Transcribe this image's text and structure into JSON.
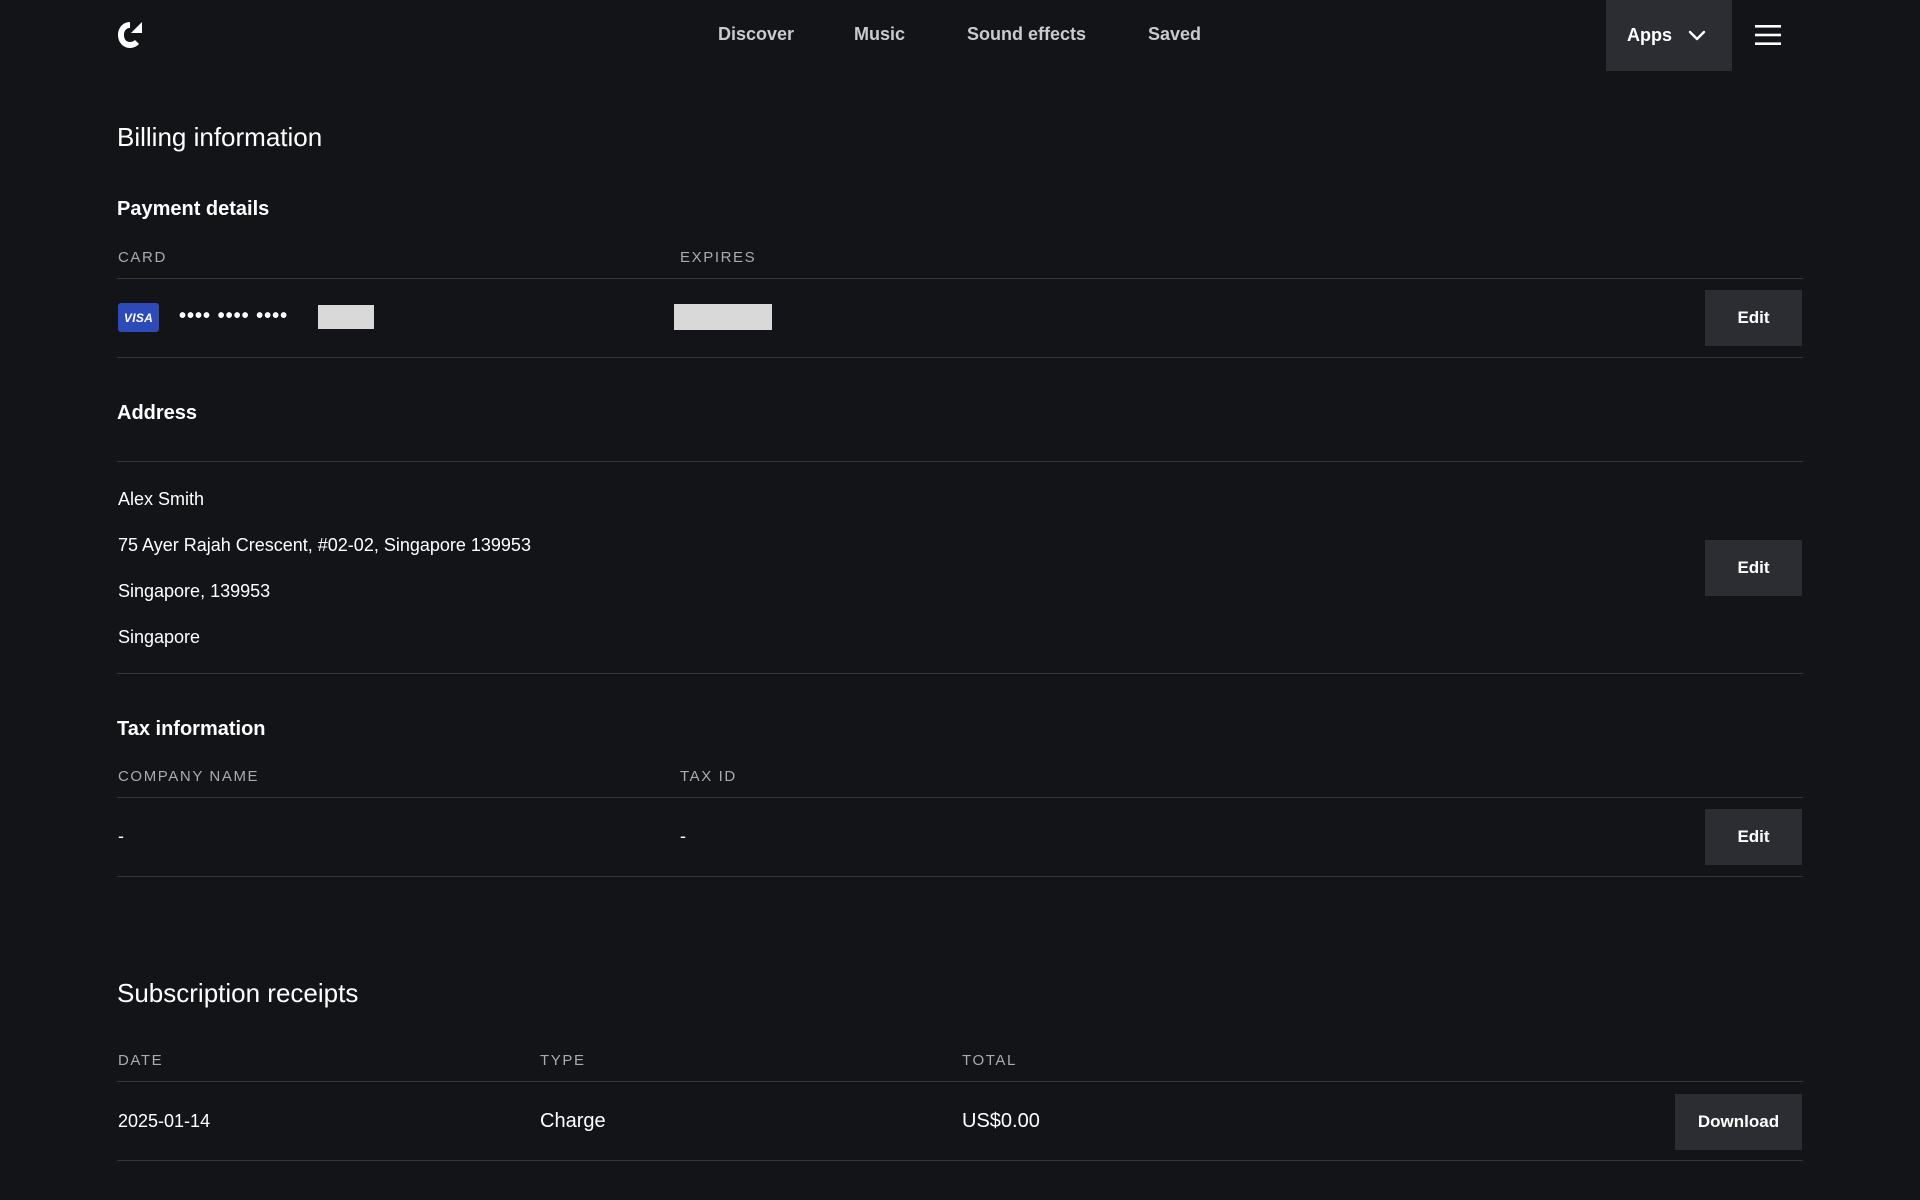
{
  "header": {
    "logo_icon": "brand-logo-icon",
    "nav": [
      {
        "label": "Discover"
      },
      {
        "label": "Music"
      },
      {
        "label": "Sound effects"
      },
      {
        "label": "Saved"
      }
    ],
    "apps_label": "Apps",
    "apps_icon": "chevron-down-icon",
    "menu_icon": "hamburger-menu-icon"
  },
  "billing": {
    "title": "Billing information",
    "payment": {
      "heading": "Payment details",
      "col_card": "CARD",
      "col_expires": "EXPIRES",
      "card_brand": "VISA",
      "card_masked": "•••• •••• ••••",
      "edit_label": "Edit"
    },
    "address": {
      "heading": "Address",
      "lines": [
        "Alex Smith",
        "75 Ayer Rajah Crescent, #02-02, Singapore 139953",
        "Singapore, 139953",
        "Singapore"
      ],
      "edit_label": "Edit"
    },
    "tax": {
      "heading": "Tax information",
      "col_company": "COMPANY NAME",
      "col_tax_id": "TAX ID",
      "company_value": "-",
      "tax_id_value": "-",
      "edit_label": "Edit"
    }
  },
  "receipts": {
    "title": "Subscription receipts",
    "columns": [
      "DATE",
      "TYPE",
      "TOTAL"
    ],
    "rows": [
      {
        "date": "2025-01-14",
        "type": "Charge",
        "total": "US$0.00",
        "action": "Download"
      }
    ]
  },
  "colors": {
    "background": "#131418",
    "button": "#2b2d33",
    "visa": "#2c4bb8"
  }
}
